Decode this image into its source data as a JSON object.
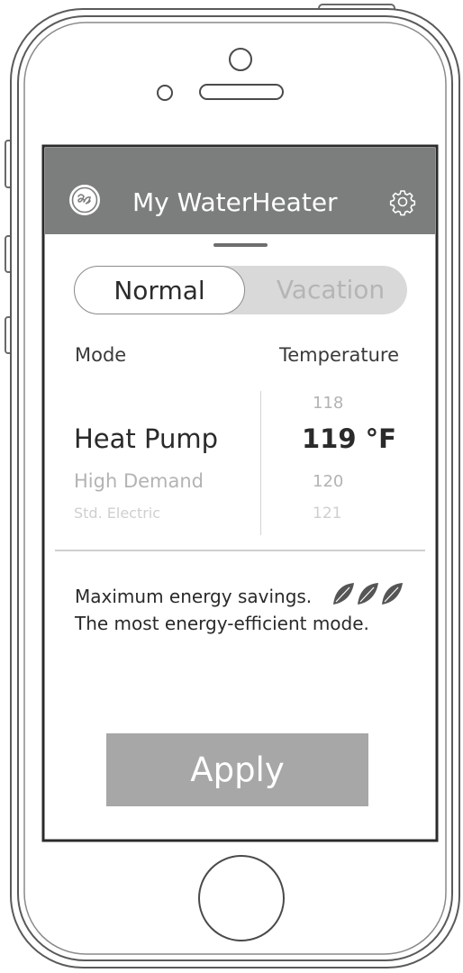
{
  "app": {
    "title": "My WaterHeater"
  },
  "toggle": {
    "active": "Normal",
    "inactive": "Vacation"
  },
  "columns": {
    "mode_header": "Mode",
    "temperature_header": "Temperature"
  },
  "modes": [
    "Heat Pump",
    "High Demand",
    "Std. Electric"
  ],
  "selected_mode": "Heat Pump",
  "temperatures": [
    "118",
    "119 °F",
    "120",
    "121"
  ],
  "selected_temperature": "119 °F",
  "description": {
    "line1": "Maximum energy savings.",
    "line2": "The most energy-efficient mode.",
    "leaf_count": 3
  },
  "apply_label": "Apply",
  "colors": {
    "header_bg": "#7b7e7d",
    "apply_bg": "#a7a7a7",
    "toggle_bg": "#d9d9d9",
    "leaf": "#555555"
  },
  "icons": [
    "ge-logo-icon",
    "gear-icon",
    "leaf-icon"
  ]
}
